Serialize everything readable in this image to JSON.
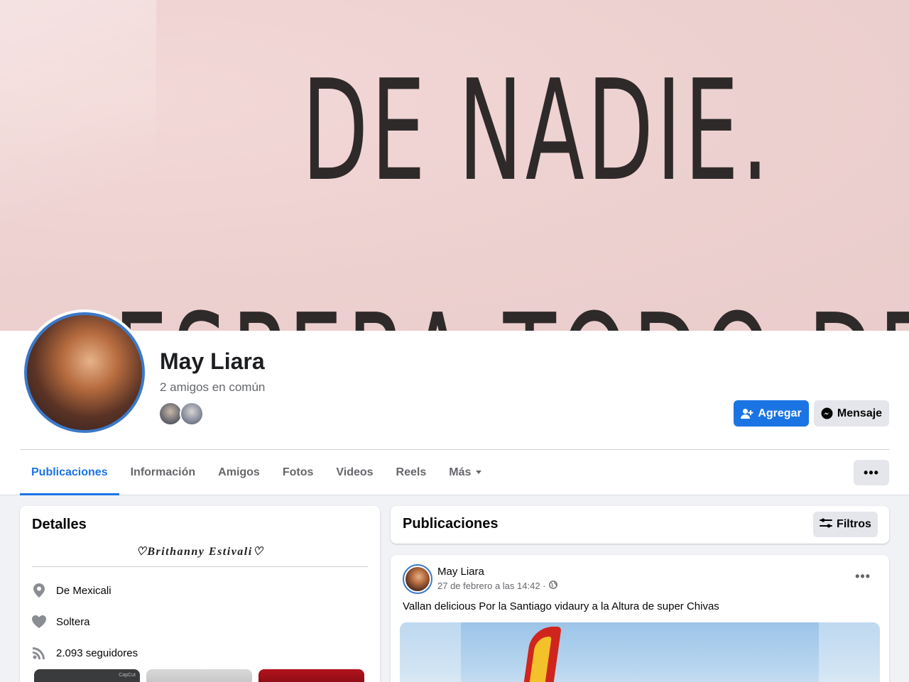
{
  "cover": {
    "line1": "DE NADIE.",
    "line2": "ESPERA TODO DE TI"
  },
  "profile": {
    "name": "May Liara",
    "mutual_friends": "2 amigos en común",
    "buttons": {
      "add": "Agregar",
      "message": "Mensaje"
    }
  },
  "tabs": [
    {
      "label": "Publicaciones",
      "active": true
    },
    {
      "label": "Información"
    },
    {
      "label": "Amigos"
    },
    {
      "label": "Fotos"
    },
    {
      "label": "Videos"
    },
    {
      "label": "Reels"
    },
    {
      "label": "Más"
    }
  ],
  "more_button": "•••",
  "details": {
    "title": "Detalles",
    "bio": "♡Brithanny Estivali♡",
    "rows": [
      {
        "icon": "location-pin-icon",
        "prefix": "De",
        "value": "Mexicali"
      },
      {
        "icon": "heart-icon",
        "prefix": "",
        "value": "Soltera"
      },
      {
        "icon": "followers-icon",
        "prefix": "",
        "value": "2.093 seguidores"
      }
    ],
    "thumb_label": "CapCut"
  },
  "posts": {
    "title": "Publicaciones",
    "filter_label": "Filtros",
    "items": [
      {
        "author": "May Liara",
        "timestamp": "27 de febrero a las 14:42 ·",
        "privacy_icon": "globe-icon",
        "text": "Vallan delicious Por la Santiago vidaury a la Altura de super Chivas",
        "dots": "•••"
      }
    ]
  },
  "colors": {
    "accent": "#1b74e4",
    "background": "#f0f2f5",
    "secondary_text": "#65676b"
  }
}
